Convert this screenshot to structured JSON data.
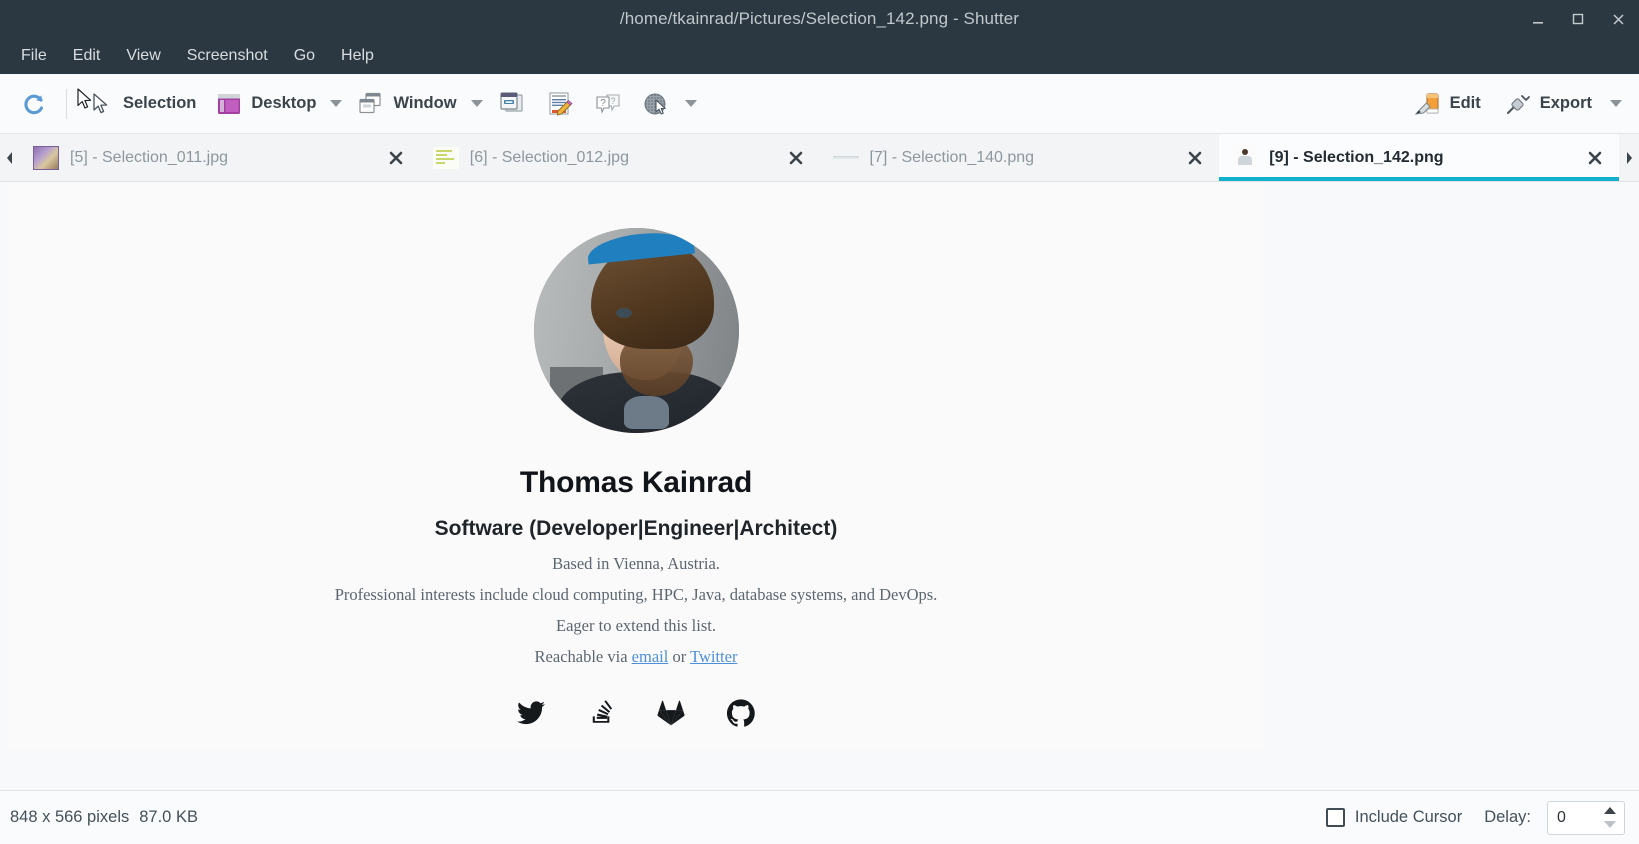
{
  "window": {
    "title": "/home/tkainrad/Pictures/Selection_142.png - Shutter",
    "minimize_label": "–",
    "maximize_label": "☐",
    "close_label": "✕"
  },
  "menubar": {
    "items": [
      {
        "label": "File"
      },
      {
        "label": "Edit"
      },
      {
        "label": "View"
      },
      {
        "label": "Screenshot"
      },
      {
        "label": "Go"
      },
      {
        "label": "Help"
      }
    ]
  },
  "toolbar": {
    "redo_icon": "redo-circular-arrow-icon",
    "selection_label": "Selection",
    "selection_icon": "cursor-arrow-icon",
    "desktop_label": "Desktop",
    "desktop_icon": "desktop-window-icon",
    "desktop_caret": "chevron-down-icon",
    "window_label": "Window",
    "window_icon": "windows-stack-icon",
    "window_caret": "chevron-down-icon",
    "menu_icon": "menu-capture-icon",
    "website_icon": "website-capture-icon",
    "tooltip_icon": "tooltip-capture-icon",
    "redo_last_icon": "redo-last-capture-icon",
    "extra_caret": "chevron-down-icon",
    "edit_label": "Edit",
    "edit_icon": "paint-brush-icon",
    "export_label": "Export",
    "export_icon": "export-plug-icon",
    "export_caret": "chevron-down-icon"
  },
  "tabs": {
    "scroll_left_icon": "chevron-left-icon",
    "scroll_right_icon": "chevron-right-icon",
    "close_icon": "close-x-icon",
    "items": [
      {
        "title": "[5] - Selection_011.jpg",
        "thumb": "thumb-image-purple",
        "active": false
      },
      {
        "title": "[6] - Selection_012.jpg",
        "thumb": "thumb-text-lines",
        "active": false
      },
      {
        "title": "[7] - Selection_140.png",
        "thumb": "thumb-thin-line",
        "active": false
      },
      {
        "title": "[9] - Selection_142.png",
        "thumb": "thumb-person",
        "active": true
      }
    ]
  },
  "content": {
    "avatar_alt": "portrait-photo",
    "name": "Thomas Kainrad",
    "role": "Software (Developer|Engineer|Architect)",
    "location": "Based in Vienna, Austria.",
    "interests": "Professional interests include cloud computing, HPC, Java, database systems, and DevOps.",
    "extend": "Eager to extend this list.",
    "contact_prefix": "Reachable via ",
    "contact_link1": "email",
    "contact_middle": " or ",
    "contact_link2": "Twitter",
    "socials": [
      {
        "name": "twitter-icon"
      },
      {
        "name": "stackoverflow-icon"
      },
      {
        "name": "gitlab-icon"
      },
      {
        "name": "github-icon"
      }
    ]
  },
  "statusbar": {
    "dimensions": "848 x 566 pixels",
    "filesize": "87.0 KB",
    "include_cursor_label": "Include Cursor",
    "include_cursor_checked": false,
    "delay_label": "Delay:",
    "delay_value": "0"
  },
  "colors": {
    "titlebar_bg": "#2b3841",
    "toolbar_bg": "#fafbfc",
    "active_tab_underline": "#13b0cc",
    "link": "#4d90d8"
  }
}
